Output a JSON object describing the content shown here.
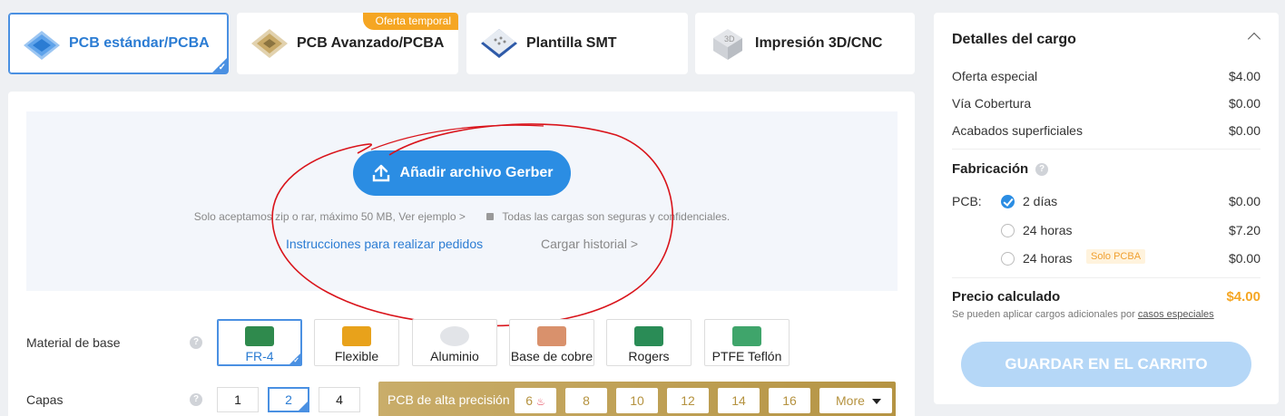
{
  "tabs": [
    {
      "label": "PCB estándar/PCBA",
      "icon": "pcb-standard-icon",
      "active": true
    },
    {
      "label": "PCB Avanzado/PCBA",
      "icon": "pcb-advanced-icon",
      "badge": "Oferta temporal"
    },
    {
      "label": "Plantilla SMT",
      "icon": "smt-stencil-icon"
    },
    {
      "label": "Impresión 3D/CNC",
      "icon": "3d-print-icon"
    }
  ],
  "upload": {
    "button_label": "Añadir archivo Gerber",
    "note": "Solo aceptamos zip o rar, máximo 50 MB, Ver ejemplo >",
    "secure_note": "Todas las cargas son seguras y confidenciales.",
    "instructions_link": "Instrucciones para realizar pedidos",
    "history_link": "Cargar historial >"
  },
  "base_material": {
    "label": "Material de base",
    "help": "?",
    "options": [
      "FR-4",
      "Flexible",
      "Aluminio",
      "Base de cobre",
      "Rogers",
      "PTFE Teflón"
    ],
    "selected": "FR-4"
  },
  "layers": {
    "label": "Capas",
    "help": "?",
    "options": [
      "1",
      "2",
      "4"
    ],
    "selected": "2",
    "high_precision_label": "PCB de alta precisión",
    "high_precision_options": [
      "6",
      "8",
      "10",
      "12",
      "14",
      "16"
    ],
    "more_label": "More"
  },
  "charges": {
    "title": "Detalles del cargo",
    "items": [
      {
        "label": "Oferta especial",
        "value": "$4.00"
      },
      {
        "label": "Vía Cobertura",
        "value": "$0.00"
      },
      {
        "label": "Acabados superficiales",
        "value": "$0.00"
      }
    ],
    "fabrication_title": "Fabricación",
    "pcb_label": "PCB:",
    "fabrication_options": [
      {
        "label": "2 días",
        "value": "$0.00",
        "selected": true
      },
      {
        "label": "24 horas",
        "value": "$7.20"
      },
      {
        "label": "24 horas",
        "value": "$0.00",
        "badge": "Solo PCBA"
      }
    ],
    "calculated_label": "Precio calculado",
    "calculated_value": "$4.00",
    "note": "Se pueden aplicar cargos adicionales por",
    "note_link": "casos especiales",
    "cart_button": "GUARDAR EN EL CARRITO"
  },
  "colors": {
    "accent": "#2b8de3",
    "price": "#f5a623",
    "gold": "#b59443",
    "annotation": "#d9141b"
  }
}
